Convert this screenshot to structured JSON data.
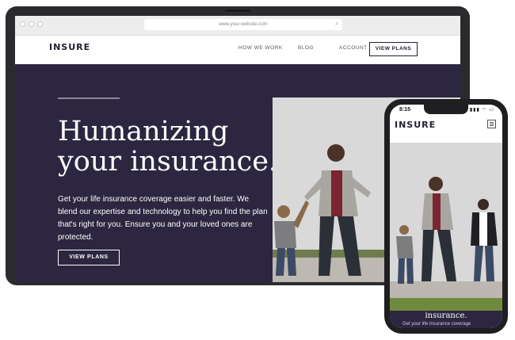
{
  "browser": {
    "url": "www.your-website.com"
  },
  "site": {
    "logo": "INSURE",
    "nav": [
      "HOW WE WORK",
      "BLOG",
      "ACCOUNT"
    ],
    "nav_cta": "VIEW PLANS"
  },
  "hero": {
    "headline_line1": "Humanizing",
    "headline_line2": "your insurance.",
    "body": "Get your life insurance coverage easier and faster. We blend our expertise and technology to help you find the plan that's right for you. Ensure you and your loved ones are protected.",
    "cta": "VIEW PLANS"
  },
  "phone": {
    "time": "8:15",
    "status_icons": "▮▮▮ ◠ ▭",
    "logo": "INSURE",
    "hero_fragment": "insurance.",
    "body_fragment": "Get your life insurance coverage"
  },
  "colors": {
    "hero_bg": "#2c2640",
    "ink": "#24202f",
    "device": "#2b2b2f"
  }
}
